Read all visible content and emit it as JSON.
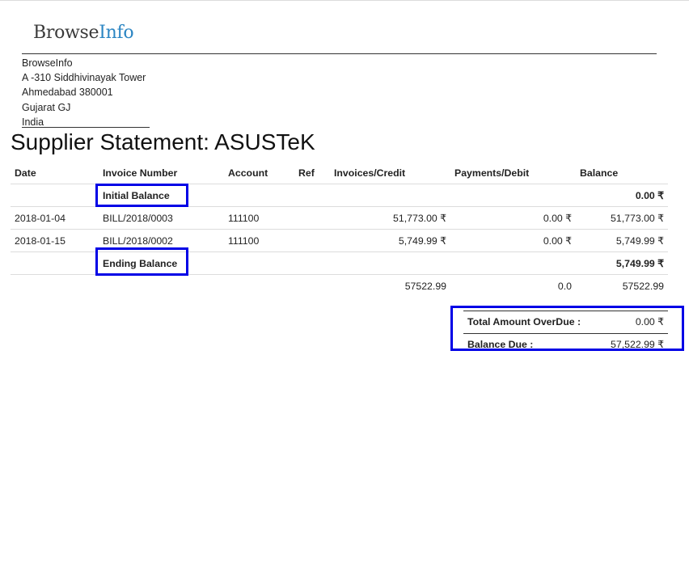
{
  "logo": {
    "part1": "Browse",
    "part2": "Info"
  },
  "company": {
    "name": "BrowseInfo",
    "address_line1": "A -310 Siddhivinayak Tower",
    "address_line2": "Ahmedabad 380001",
    "address_line3": "Gujarat GJ",
    "country": "India"
  },
  "title": "Supplier Statement: ASUSTeK",
  "table": {
    "headers": {
      "date": "Date",
      "invoice_number": "Invoice Number",
      "account": "Account",
      "ref": "Ref",
      "invoices_credit": "Invoices/Credit",
      "payments_debit": "Payments/Debit",
      "balance": "Balance"
    },
    "initial_balance": {
      "label": "Initial Balance",
      "balance": "0.00 ₹"
    },
    "rows": [
      {
        "date": "2018-01-04",
        "invoice_number": "BILL/2018/0003",
        "account": "111100",
        "ref": "",
        "invoices_credit": "51,773.00 ₹",
        "payments_debit": "0.00 ₹",
        "balance": "51,773.00 ₹"
      },
      {
        "date": "2018-01-15",
        "invoice_number": "BILL/2018/0002",
        "account": "111100",
        "ref": "",
        "invoices_credit": "5,749.99 ₹",
        "payments_debit": "0.00 ₹",
        "balance": "5,749.99 ₹"
      }
    ],
    "ending_balance": {
      "label": "Ending Balance",
      "balance": "5,749.99 ₹"
    },
    "totals": {
      "invoices_credit": "57522.99",
      "payments_debit": "0.0",
      "balance": "57522.99"
    }
  },
  "summary": {
    "overdue_label": "Total Amount OverDue :",
    "overdue_value": "0.00 ₹",
    "balance_due_label": "Balance Due :",
    "balance_due_value": "57,522.99 ₹"
  },
  "highlight_color": "#0000e6"
}
